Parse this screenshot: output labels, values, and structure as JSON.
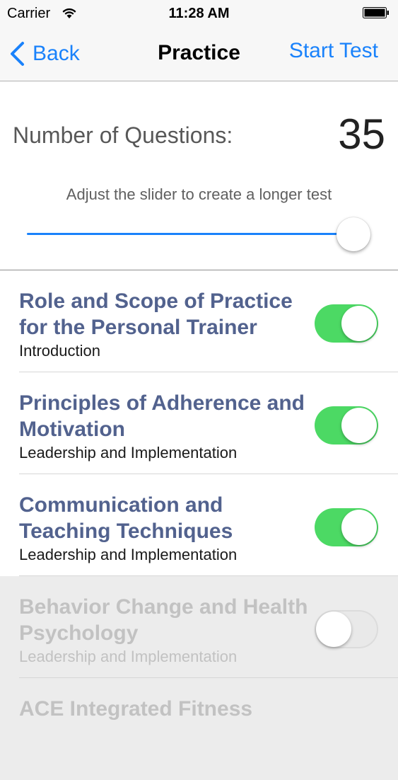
{
  "status_bar": {
    "carrier": "Carrier",
    "time": "11:28 AM",
    "wifi_icon": "wifi-icon",
    "battery_icon": "battery-icon"
  },
  "nav": {
    "back_label": "Back",
    "title": "Practice",
    "start_label": "Start Test"
  },
  "config": {
    "number_label": "Number of Questions:",
    "number_value": "35",
    "hint": "Adjust the slider to create a longer test",
    "slider_level": 1.0
  },
  "topics": [
    {
      "title": "Role and Scope of Practice for the Personal Trainer",
      "subtitle": "Introduction",
      "enabled": true
    },
    {
      "title": "Principles of Adherence and Motivation",
      "subtitle": "Leadership and Implementation",
      "enabled": true
    },
    {
      "title": "Communication and Teaching Techniques",
      "subtitle": "Leadership and Implementation",
      "enabled": true
    },
    {
      "title": "Behavior Change and Health Psychology",
      "subtitle": "Leadership and Implementation",
      "enabled": false
    },
    {
      "title": "ACE Integrated Fitness",
      "subtitle": "",
      "enabled": false
    }
  ],
  "colors": {
    "accent": "#1a82fb",
    "toggle_on": "#4cd964",
    "topic_title": "#52628e"
  }
}
